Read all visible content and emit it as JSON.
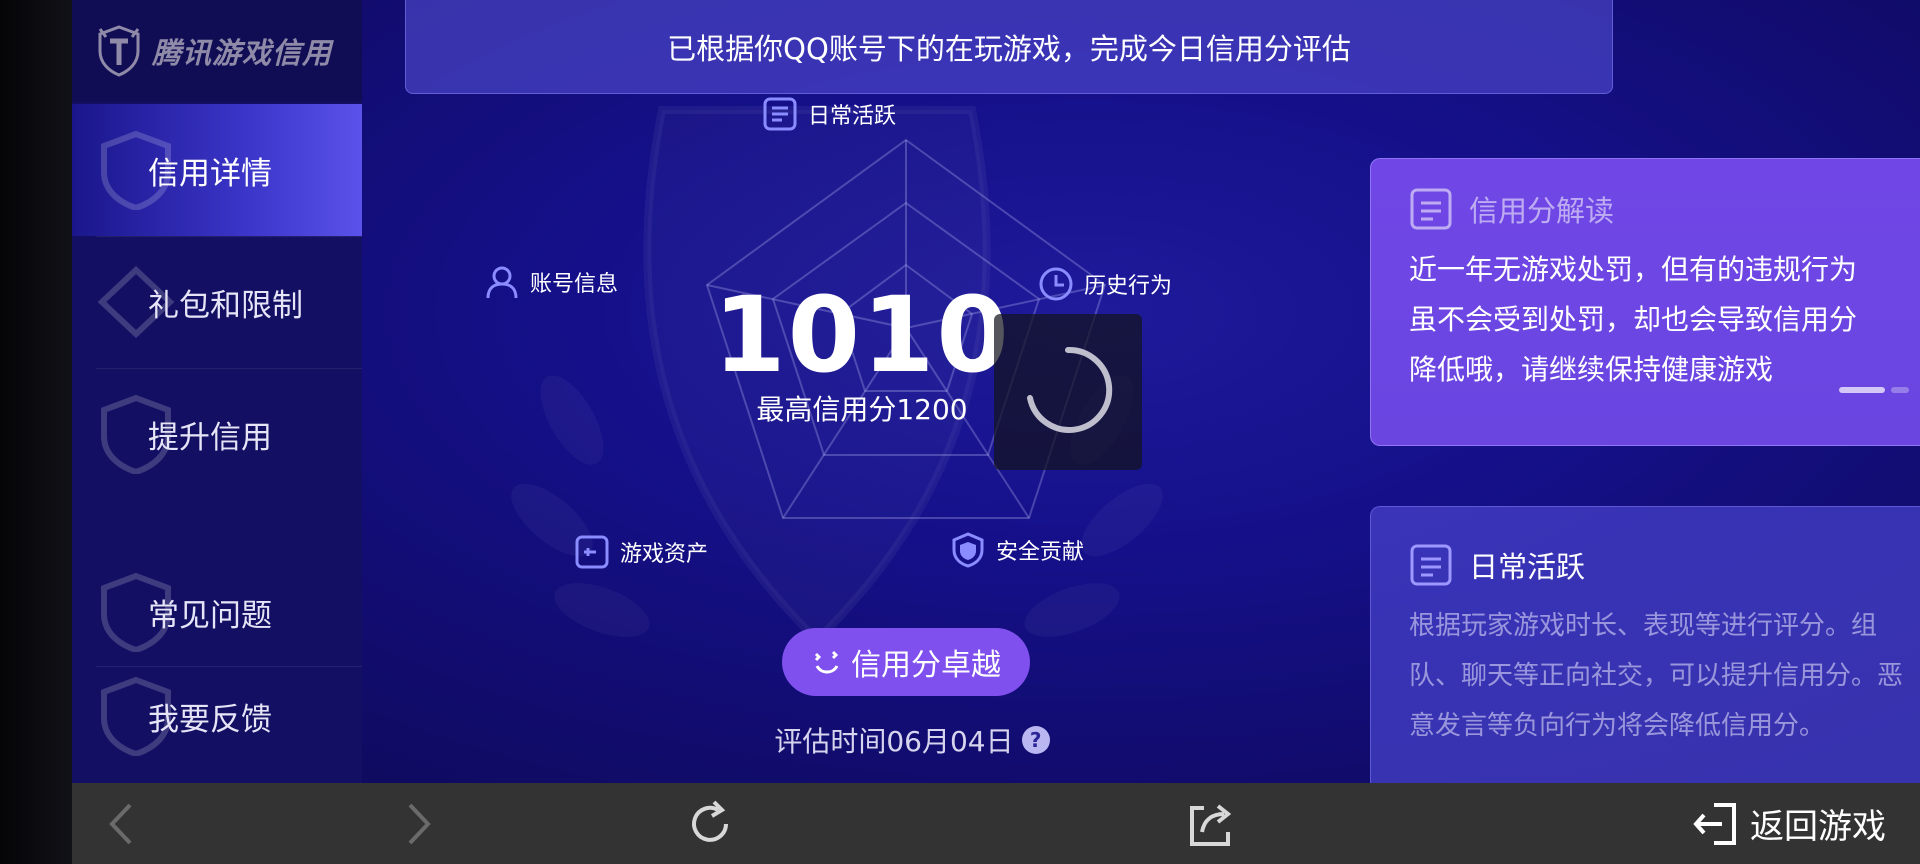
{
  "sidebar": {
    "logo_text": "腾讯游戏信用",
    "items": [
      {
        "label": "信用详情",
        "active": true
      },
      {
        "label": "礼包和限制",
        "active": false
      },
      {
        "label": "提升信用",
        "active": false
      },
      {
        "label": "常见问题",
        "active": false
      },
      {
        "label": "我要反馈",
        "active": false
      }
    ]
  },
  "banner": {
    "text": "已根据你QQ账号下的在玩游戏，完成今日信用分评估"
  },
  "radar": {
    "dimensions": [
      {
        "label": "日常活跃",
        "icon": "doc-icon"
      },
      {
        "label": "历史行为",
        "icon": "clock-icon"
      },
      {
        "label": "安全贡献",
        "icon": "shield-icon"
      },
      {
        "label": "游戏资产",
        "icon": "asset-icon"
      },
      {
        "label": "账号信息",
        "icon": "user-icon"
      }
    ]
  },
  "score": {
    "value": "1010",
    "max_label": "最高信用分1200",
    "level_label": "信用分卓越",
    "eval_time": "评估时间06月04日",
    "help": "?"
  },
  "interpret_card": {
    "title": "信用分解读",
    "lines": [
      "近一年无游戏处罚，但有的违规行为",
      "虽不会受到处罚，却也会导致信用分",
      "降低哦，请继续保持健康游戏"
    ]
  },
  "daily_card": {
    "title": "日常活跃",
    "lines": [
      "根据玩家游戏时长、表现等进行评分。组",
      "队、聊天等正向社交，可以提升信用分。恶",
      "意发言等负向行为将会降低信用分。"
    ]
  },
  "bottombar": {
    "return_label": "返回游戏"
  },
  "colors": {
    "accent_purple": "#8050ee",
    "sidebar_bg": "#130f63",
    "bottombar_bg": "#333333"
  }
}
